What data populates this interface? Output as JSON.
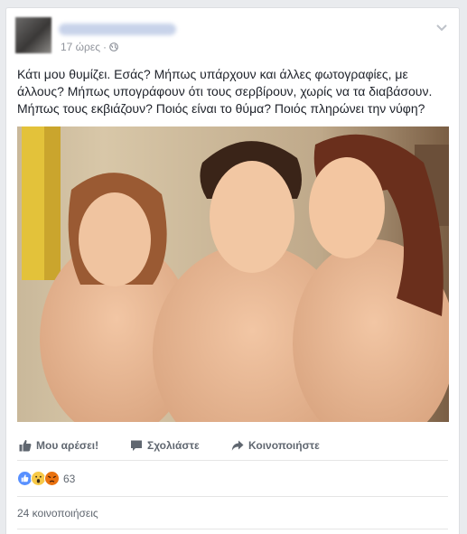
{
  "post": {
    "time": "17 ώρες",
    "separator": "·",
    "text": "Κάτι μου θυμίζει. Εσάς? Μήπως υπάρχουν και άλλες φωτογραφίες, με άλλους? Μήπως υπογράφουν ότι τους σερβίρουν, χωρίς να τα διαβάσουν. Μήπως τους εκβιάζουν? Ποιός είναι το θύμα? Ποιός πληρώνει την νύφη?"
  },
  "actions": {
    "like": "Μου αρέσει!",
    "comment": "Σχολιάστε",
    "share": "Κοινοποιήστε"
  },
  "reactions": {
    "types": [
      "like-icon",
      "wow-icon",
      "angry-icon"
    ],
    "count": "63"
  },
  "shares": "24 κοινοποιήσεις",
  "colors": {
    "like_blue": "#5890ff",
    "wow_yellow": "#f7c948",
    "angry_red": "#e9710f",
    "meta_gray": "#90949c"
  }
}
